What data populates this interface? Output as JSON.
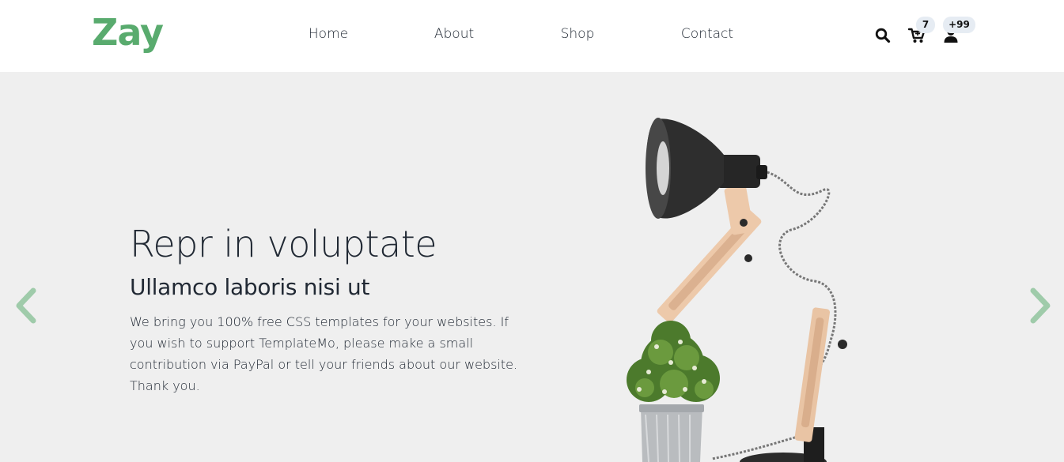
{
  "brand": {
    "name": "Zay",
    "color": "#59ab6e"
  },
  "nav": {
    "items": [
      {
        "label": "Home"
      },
      {
        "label": "About"
      },
      {
        "label": "Shop"
      },
      {
        "label": "Contact"
      }
    ]
  },
  "icons": {
    "search": "search-icon",
    "cart": "cart-icon",
    "user": "user-icon"
  },
  "badges": {
    "cart_count": "7",
    "user_count": "+99"
  },
  "hero": {
    "title": "Repr in voluptate",
    "subtitle": "Ullamco laboris nisi ut",
    "description": "We bring you 100% free CSS templates for your websites. If you wish to support TemplateMo, please make a small contribution via PayPal or tell your friends about our website. Thank you.",
    "image": "desk-lamp-and-potted-plant",
    "background": "#efefef"
  },
  "carousel": {
    "prev_icon": "chevron-left-icon",
    "next_icon": "chevron-right-icon",
    "arrow_color": "#9fcbaa"
  }
}
